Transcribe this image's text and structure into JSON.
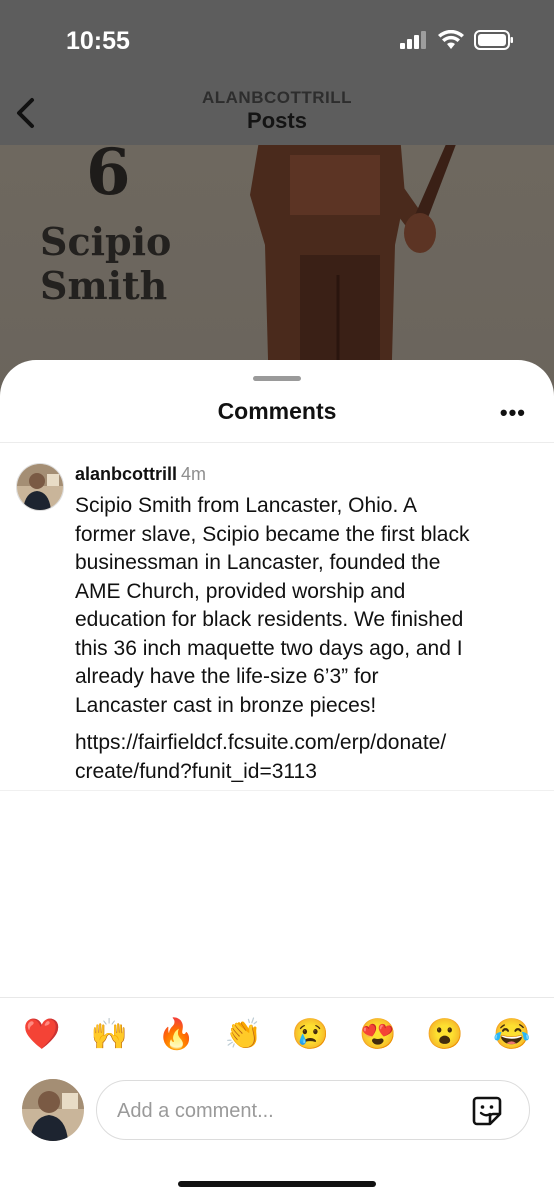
{
  "status": {
    "time": "10:55"
  },
  "nav": {
    "username": "ALANBCOTTRILL",
    "title": "Posts"
  },
  "post": {
    "caption": "Scipio\nSmith",
    "quote_mark": "6"
  },
  "sheet": {
    "title": "Comments"
  },
  "comment": {
    "username": "alanbcottrill",
    "time": "4m",
    "text": "Scipio Smith from Lancaster, Ohio. A\nformer slave, Scipio became the first black\nbusinessman in Lancaster, founded the\nAME Church, provided worship and\neducation for black residents. We finished\nthis 36 inch maquette two days ago, and I\nalready have the life-size 6’3” for\nLancaster cast in bronze pieces!",
    "link": "https://fairfieldcf.fcsuite.com/erp/donate/\ncreate/fund?funit_id=3113"
  },
  "reactions": [
    "❤️",
    "🙌",
    "🔥",
    "👏",
    "😢",
    "😍",
    "😮",
    "😂"
  ],
  "composer": {
    "placeholder": "Add a comment..."
  }
}
